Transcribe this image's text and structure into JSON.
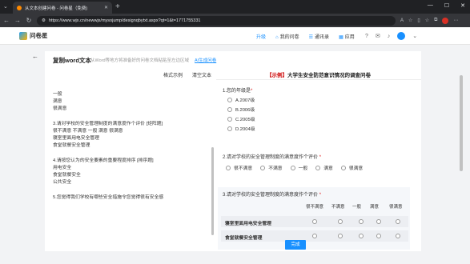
{
  "browser": {
    "tab_title": "从文本创建问卷 - 问卷星（免费)",
    "url": "https://www.wjx.cn/newwjx/mysojump/designq​bytxt.aspx?qt=1&t=1771755331",
    "url_display": "https://www.wjx.cn/newwjx/mysojump/designqbytxt.aspx?qt=1&t=1771755331"
  },
  "app": {
    "logo_text": "问卷星",
    "nav": {
      "upgrade": "升级",
      "my_surveys": "我的问卷",
      "contacts": "通讯录",
      "apps": "应用"
    }
  },
  "editor": {
    "title": "复制word文本",
    "hint": "从Word等地方将准备好的问卷文档粘贴至左边区域",
    "link": "AI生成问卷",
    "tabs": [
      "格式示例",
      "清空文本"
    ],
    "text_lines": [
      "一般",
      "满意",
      "很满意",
      "",
      "3.请对学校的安全管理制度的满意度作个评价 [矩阵题]",
      "很不满意 不满意 一般 满意 很满意",
      "寝室里面用电安全管理",
      "食堂就餐安全管理",
      "",
      "4.请按您认为的安全要素的重要程度排序 [排序题]",
      "用电安全",
      "食堂就餐安全",
      "公共安全",
      "",
      "5.您觉得我们学校有哪些安全措施令您觉得很有安全感"
    ],
    "done_button": "完成"
  },
  "preview": {
    "heading_tag": "【示例】",
    "heading": "大学生安全防范意识情况的调查问卷",
    "q1": {
      "label": "1.您的年级是",
      "options": [
        "A.2007级",
        "B.2006级",
        "C.2005级",
        "D.2004级"
      ]
    },
    "q2": {
      "label": "2.请对学校的安全管理制度的满意度作个评价",
      "options": [
        "很不满意",
        "不满意",
        "一般",
        "满意",
        "很满意"
      ]
    },
    "q3": {
      "label": "3.请对学校的安全管理制度的满意度作个评价",
      "columns": [
        "很不满意",
        "不满意",
        "一般",
        "满意",
        "很满意"
      ],
      "rows": [
        "寝室里面用电安全管理",
        "食堂就餐安全管理"
      ]
    },
    "required_mark": "*"
  }
}
